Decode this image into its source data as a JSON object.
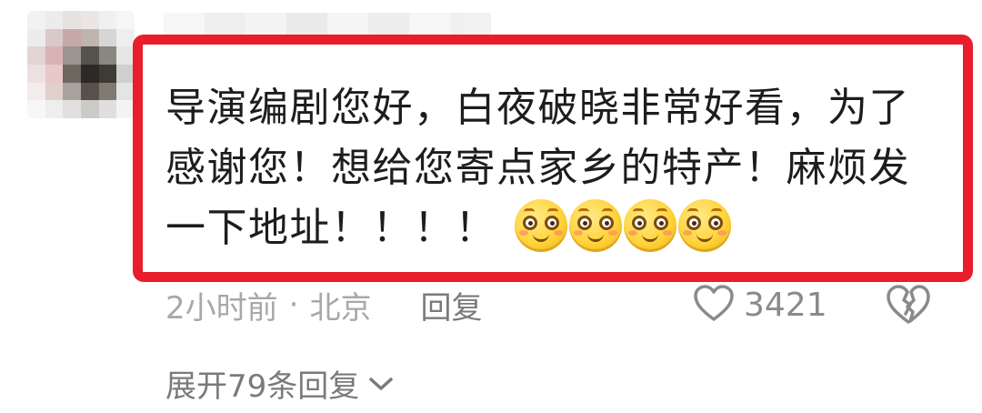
{
  "comment": {
    "text": "导演编剧您好，白夜破晓非常好看，为了感谢您！想给您寄点家乡的特产！麻烦发一下地址！！！！",
    "emojis": [
      "smile-emoji",
      "smile-emoji",
      "smile-emoji",
      "smile-emoji"
    ],
    "highlight_color": "#ea1d2c"
  },
  "meta": {
    "time": "2小时前",
    "separator": "·",
    "location": "北京",
    "reply_label": "回复"
  },
  "actions": {
    "like_icon": "heart-outline-icon",
    "like_count": "3421",
    "dislike_icon": "broken-heart-icon"
  },
  "replies": {
    "expand_label": "展开79条回复",
    "expand_icon": "chevron-down-icon"
  }
}
